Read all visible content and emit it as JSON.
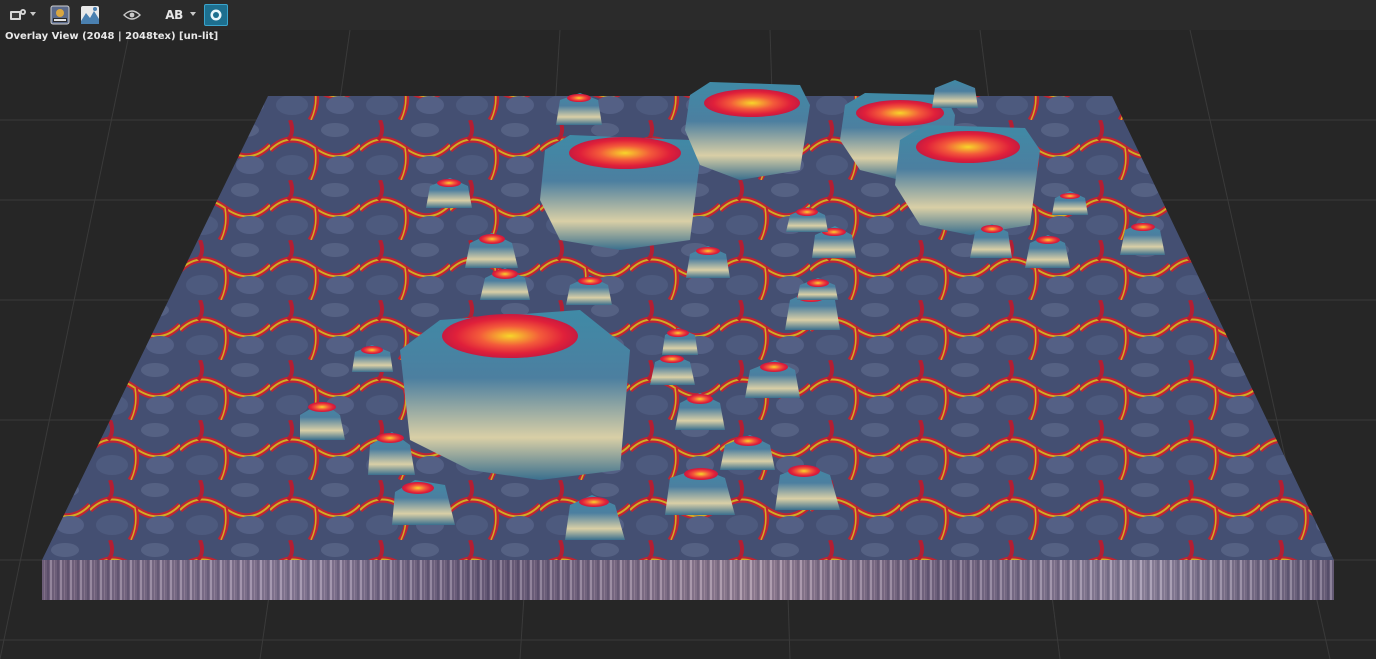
{
  "toolbar": {
    "buttons": [
      {
        "icon": "render-settings-icon"
      },
      {
        "icon": "output-image-icon"
      },
      {
        "icon": "landscape-preview-icon"
      },
      {
        "icon": "eye-icon"
      },
      {
        "icon": "ab-compare-icon",
        "label": "AB"
      },
      {
        "icon": "camera-icon"
      }
    ]
  },
  "viewport": {
    "title": "Overlay View (2048 | 2048tex)  [un-lit]"
  },
  "colors": {
    "background": "#262626",
    "grid": "#3a3a3a",
    "rock": "#4a5a7a",
    "lava_red": "#e0202a",
    "lava_yellow": "#f2c81a",
    "peak_teal": "#3f8aa6",
    "peak_cream": "#d9cfa6",
    "accent": "#1d6f8f"
  }
}
